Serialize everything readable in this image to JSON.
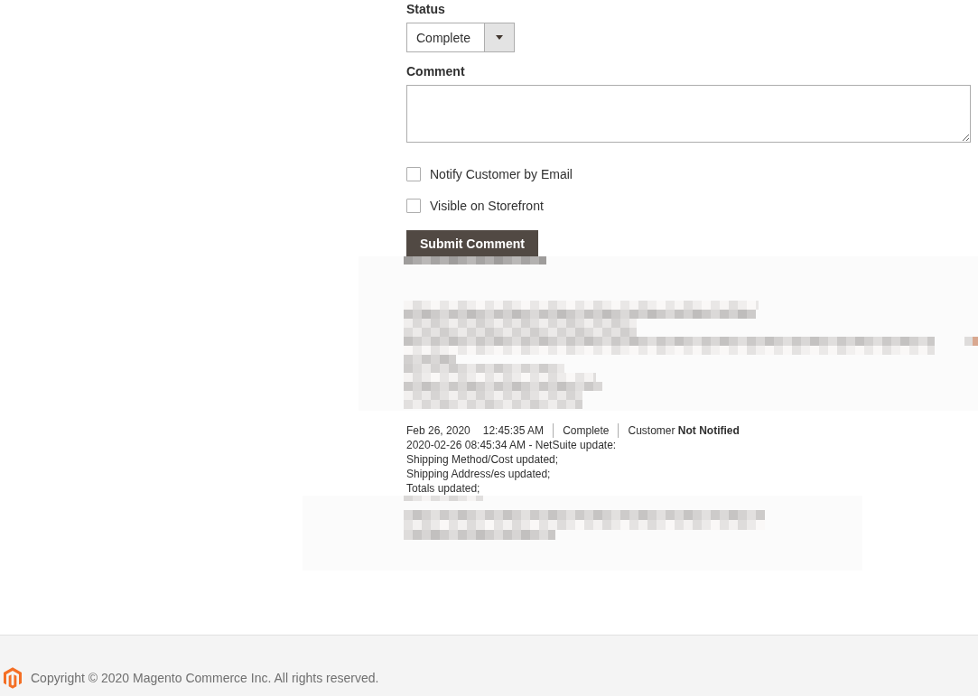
{
  "status_field": {
    "label": "Status",
    "value": "Complete"
  },
  "comment_field": {
    "label": "Comment"
  },
  "options": [
    {
      "label": "Notify Customer by Email",
      "checked": false
    },
    {
      "label": "Visible on Storefront",
      "checked": false
    }
  ],
  "submit_button": {
    "label": "Submit Comment"
  },
  "history": [
    {
      "date": "Feb 26, 2020",
      "time": "12:45:35 AM",
      "status": "Complete",
      "notification": "Customer **Not Notified**",
      "lines": [
        "2020-02-26 08:45:34 AM - NetSuite update:",
        "Shipping Method/Cost updated;",
        "Shipping Address/es updated;",
        "Totals updated;"
      ]
    }
  ],
  "footer": {
    "copyright": "Copyright © 2020 Magento Commerce Inc. All rights reserved."
  }
}
